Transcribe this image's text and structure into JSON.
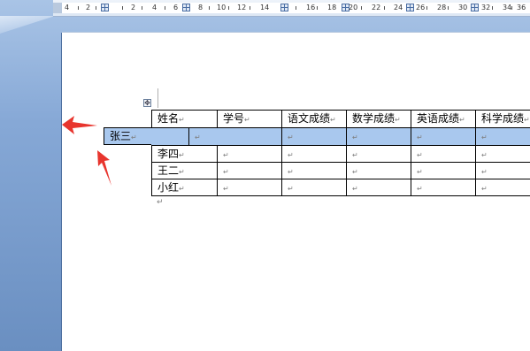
{
  "ruler": {
    "labels": [
      "4",
      "2",
      "2",
      "4",
      "6",
      "8",
      "10",
      "12",
      "14",
      "16",
      "18",
      "20",
      "22",
      "24",
      "26",
      "28",
      "30",
      "32",
      "34",
      "36"
    ]
  },
  "table": {
    "move_handle": "✥",
    "cell_mark": "↵",
    "header": [
      "姓名",
      "学号",
      "语文成绩",
      "数学成绩",
      "英语成绩",
      "科学成绩"
    ],
    "rows": [
      {
        "name": "张三",
        "selected": true
      },
      {
        "name": "李四",
        "selected": false
      },
      {
        "name": "王二",
        "selected": false
      },
      {
        "name": "小红",
        "selected": false
      }
    ]
  },
  "colors": {
    "selection": "#a9c8ee",
    "annotation_arrow": "#e8352e",
    "workspace": "#86a8d6"
  },
  "annotations": {
    "arrows": [
      "arrow-pointing-left",
      "arrow-pointing-up"
    ]
  }
}
